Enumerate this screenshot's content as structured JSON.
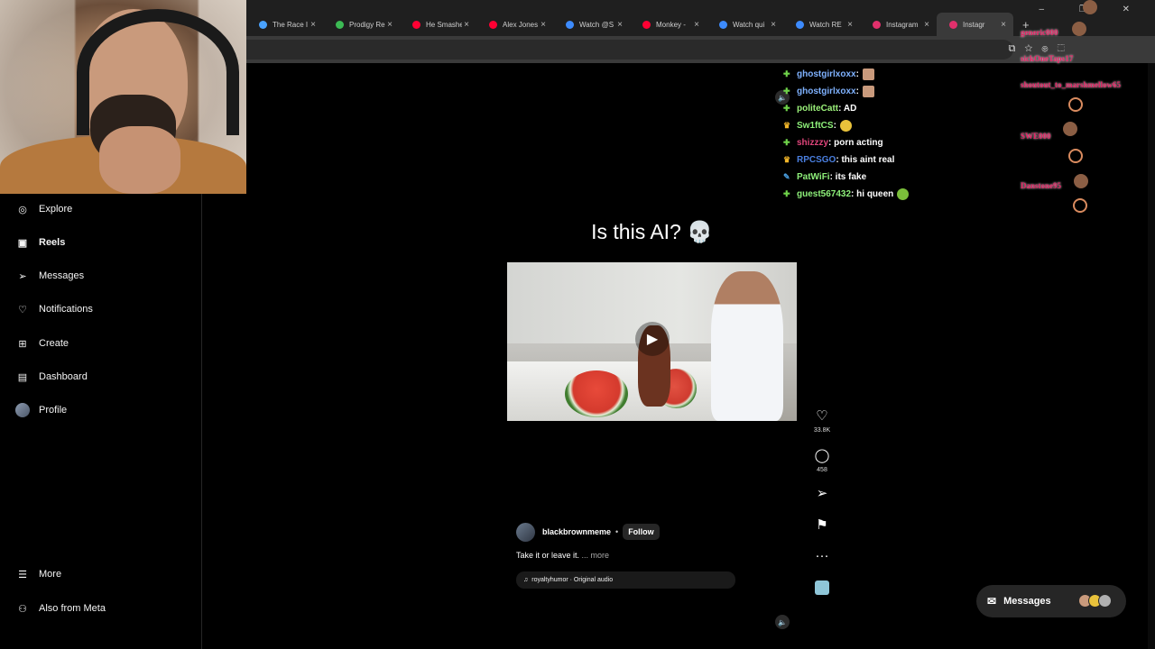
{
  "browser": {
    "tabs": [
      {
        "title": "The Race I",
        "color": "#4aa3ff"
      },
      {
        "title": "Prodigy Re",
        "color": "#3cba54"
      },
      {
        "title": "He Smashe",
        "color": "#ff0033"
      },
      {
        "title": "Alex Jones",
        "color": "#ff0033"
      },
      {
        "title": "Watch @S",
        "color": "#3d8bfd"
      },
      {
        "title": "Monkey -",
        "color": "#ff0033"
      },
      {
        "title": "Watch qui",
        "color": "#3d8bfd"
      },
      {
        "title": "Watch RE",
        "color": "#3d8bfd"
      },
      {
        "title": "Instagram",
        "color": "#e1306c"
      },
      {
        "title": "Instagr",
        "color": "#e1306c"
      }
    ],
    "new_tab": "+",
    "close_glyph": "×",
    "window_controls": "– ❐ ✕"
  },
  "sidebar": {
    "items": [
      {
        "label": "Explore",
        "icon": "compass-icon",
        "glyph": "◎"
      },
      {
        "label": "Reels",
        "icon": "reels-icon",
        "glyph": "▣"
      },
      {
        "label": "Messages",
        "icon": "send-icon",
        "glyph": "➢"
      },
      {
        "label": "Notifications",
        "icon": "heart-icon",
        "glyph": "♡"
      },
      {
        "label": "Create",
        "icon": "plus-square-icon",
        "glyph": "⊞"
      },
      {
        "label": "Dashboard",
        "icon": "dashboard-icon",
        "glyph": "▤"
      },
      {
        "label": "Profile",
        "icon": "avatar",
        "glyph": ""
      },
      {
        "label": "More",
        "icon": "menu-icon",
        "glyph": "☰"
      },
      {
        "label": "Also from Meta",
        "icon": "meta-icon",
        "glyph": "⚇"
      }
    ]
  },
  "reel": {
    "title": "Is this AI? 💀",
    "likes": "33.8K",
    "comments": "458",
    "author": "blackbrownmeme",
    "separator": "•",
    "follow_label": "Follow",
    "caption": "Take it or leave it.",
    "more_label": "... more",
    "audio": "royaltyhumor · Original audio",
    "audio_glyph": "♫",
    "play_glyph": "▶",
    "mute_glyph": "🔈",
    "more_glyph": "···"
  },
  "chat": [
    {
      "user": "ghostgirlxoxx",
      "message": "",
      "color": "#7fb2ff",
      "badge": "✚",
      "badge_color": "#6fd34a",
      "emote": "face"
    },
    {
      "user": "ghostgirlxoxx",
      "message": "",
      "color": "#7fb2ff",
      "badge": "✚",
      "badge_color": "#6fd34a",
      "emote": "face"
    },
    {
      "user": "politeCatt",
      "message": " : AD",
      "color": "#9cf27a",
      "badge": "✚",
      "badge_color": "#6fd34a",
      "emote": ""
    },
    {
      "user": "Sw1ftCS",
      "message": " : ",
      "color": "#8ef07a",
      "badge": "♛",
      "badge_color": "#f0b429",
      "emote": "yellow"
    },
    {
      "user": "shizzzy",
      "message": " : porn acting",
      "color": "#e0457b",
      "badge": "✚",
      "badge_color": "#6fd34a",
      "emote": ""
    },
    {
      "user": "RPCSGO",
      "message": " : this aint real",
      "color": "#4a7fe0",
      "badge": "♛",
      "badge_color": "#f0b429",
      "emote": ""
    },
    {
      "user": "PatWiFi",
      "message": " : its fake",
      "color": "#8ef07a",
      "badge": "✎",
      "badge_color": "#4a9fe0",
      "emote": ""
    },
    {
      "user": "guest567432",
      "message": " : hi queen",
      "color": "#8ef07a",
      "badge": "✚",
      "badge_color": "#6fd34a",
      "emote": "green"
    }
  ],
  "chat_separator": " :",
  "alerts": [
    {
      "text": "generic000"
    },
    {
      "text": "sickOneTaps17"
    },
    {
      "text": "shoutout_to_marshmellow65"
    },
    {
      "text": "SWE000"
    },
    {
      "text": "Danstone95"
    }
  ],
  "messages_pill": {
    "label": "Messages",
    "glyph": "✉"
  }
}
